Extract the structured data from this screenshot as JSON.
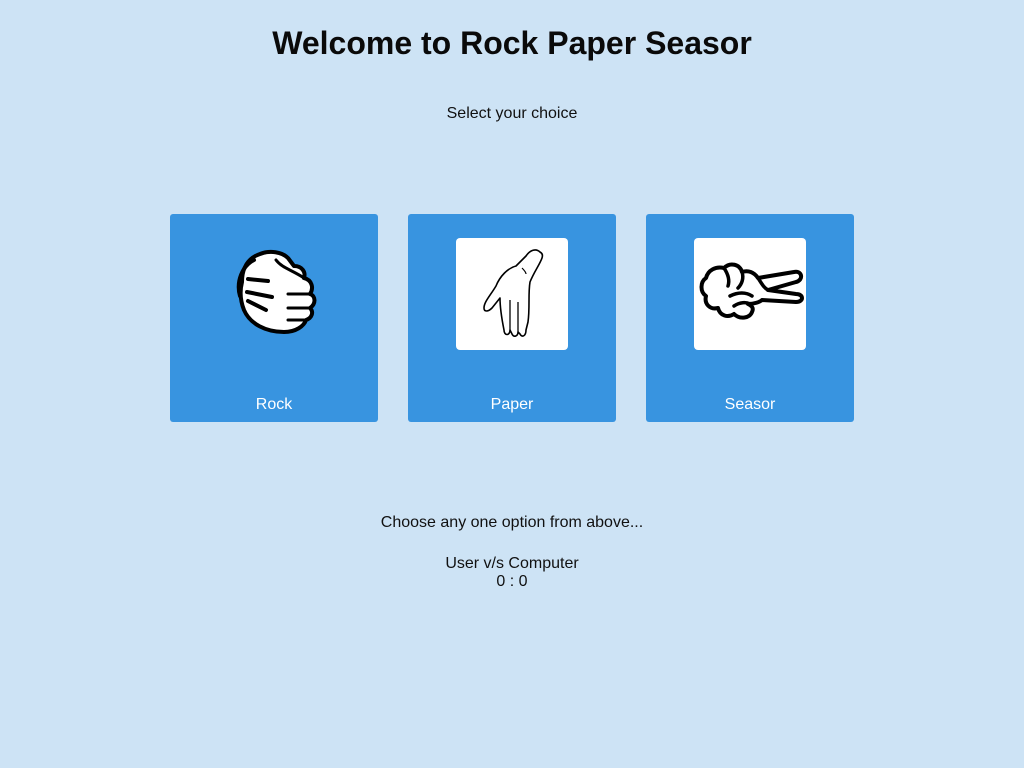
{
  "header": {
    "title": "Welcome to Rock Paper Seasor",
    "subtitle": "Select your choice"
  },
  "choices": [
    {
      "label": "Rock",
      "icon": "rock-hand-icon"
    },
    {
      "label": "Paper",
      "icon": "paper-hand-icon"
    },
    {
      "label": "Seasor",
      "icon": "scissors-hand-icon"
    }
  ],
  "status": {
    "message": "Choose any one option from above..."
  },
  "score": {
    "title": "User v/s Computer",
    "user": "0",
    "separator": ":",
    "computer": "0"
  },
  "colors": {
    "background": "#cde3f5",
    "card": "#3894e0",
    "card_text": "#ffffff"
  }
}
